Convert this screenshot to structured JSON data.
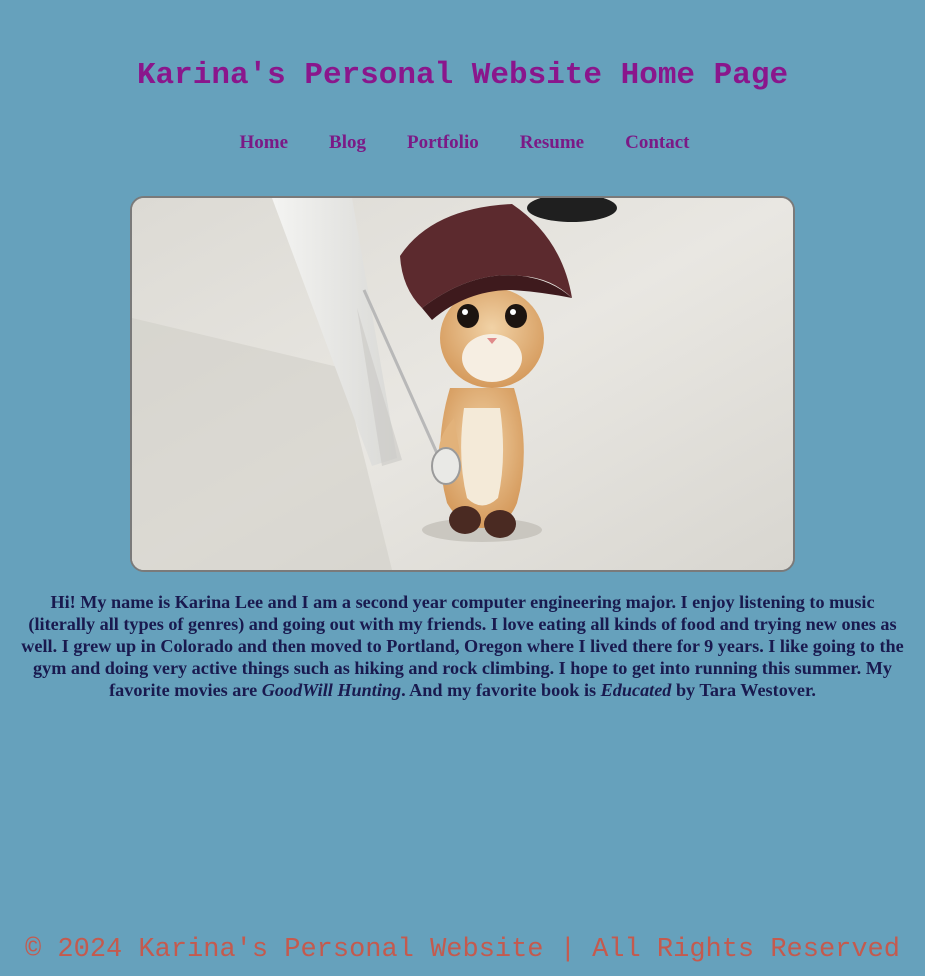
{
  "header": {
    "title": "Karina's Personal Website Home Page"
  },
  "nav": {
    "items": [
      {
        "label": "Home"
      },
      {
        "label": "Blog"
      },
      {
        "label": "Portfolio"
      },
      {
        "label": "Resume"
      },
      {
        "label": "Contact"
      }
    ]
  },
  "hero": {
    "alt": "Kitten wearing a hat holding a tiny sword"
  },
  "bio": {
    "part1": "Hi! My name is Karina Lee and I am a second year computer engineering major. I enjoy listening to music (literally all types of genres) and going out with my friends. I love eating all kinds of food and trying new ones as well. I grew up in Colorado and then moved to Portland, Oregon where I lived there for 9 years. I like going to the gym and doing very active things such as hiking and rock climbing. I hope to get into running this summer. My favorite movies are ",
    "movie": "GoodWill Hunting",
    "part2": ". And my favorite book is ",
    "book": "Educated",
    "part3": " by Tara Westover."
  },
  "footer": {
    "text": "© 2024 Karina's Personal Website | All Rights Reserved"
  },
  "colors": {
    "background": "#66a1bc",
    "title": "#8a168c",
    "nav": "#7b1a86",
    "body_text": "#191a4f",
    "footer": "#c45a4e"
  }
}
